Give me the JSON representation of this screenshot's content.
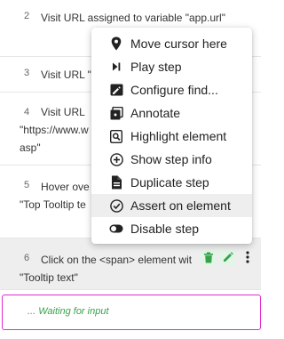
{
  "steps": [
    {
      "number": "2",
      "text": "Visit URL assigned to variable \"app.url\""
    },
    {
      "number": "3",
      "text": "Visit URL \""
    },
    {
      "number": "4",
      "line1": "Visit URL",
      "line2": "\"https://www.w",
      "line3": "asp\""
    },
    {
      "number": "5",
      "line1": "Hover ove",
      "line2": "\"Top Tooltip te"
    },
    {
      "number": "6",
      "line1": "Click on the <span> element wit",
      "line2": "\"Tooltip text\""
    }
  ],
  "waiting_text": "... Waiting for input",
  "context_menu": {
    "items": [
      {
        "label": "Move cursor here",
        "icon": "map-pin-icon"
      },
      {
        "label": "Play step",
        "icon": "play-step-icon"
      },
      {
        "label": "Configure find...",
        "icon": "configure-icon"
      },
      {
        "label": "Annotate",
        "icon": "annotate-icon"
      },
      {
        "label": "Highlight element",
        "icon": "highlight-icon"
      },
      {
        "label": "Show step info",
        "icon": "info-icon"
      },
      {
        "label": "Duplicate step",
        "icon": "duplicate-icon"
      },
      {
        "label": "Assert on element",
        "icon": "check-circle-icon",
        "active": true
      },
      {
        "label": "Disable step",
        "icon": "toggle-icon"
      }
    ]
  },
  "colors": {
    "accent_green": "#37a24a",
    "waiting_border": "#e02bd0",
    "active_row": "#eeeeee"
  }
}
